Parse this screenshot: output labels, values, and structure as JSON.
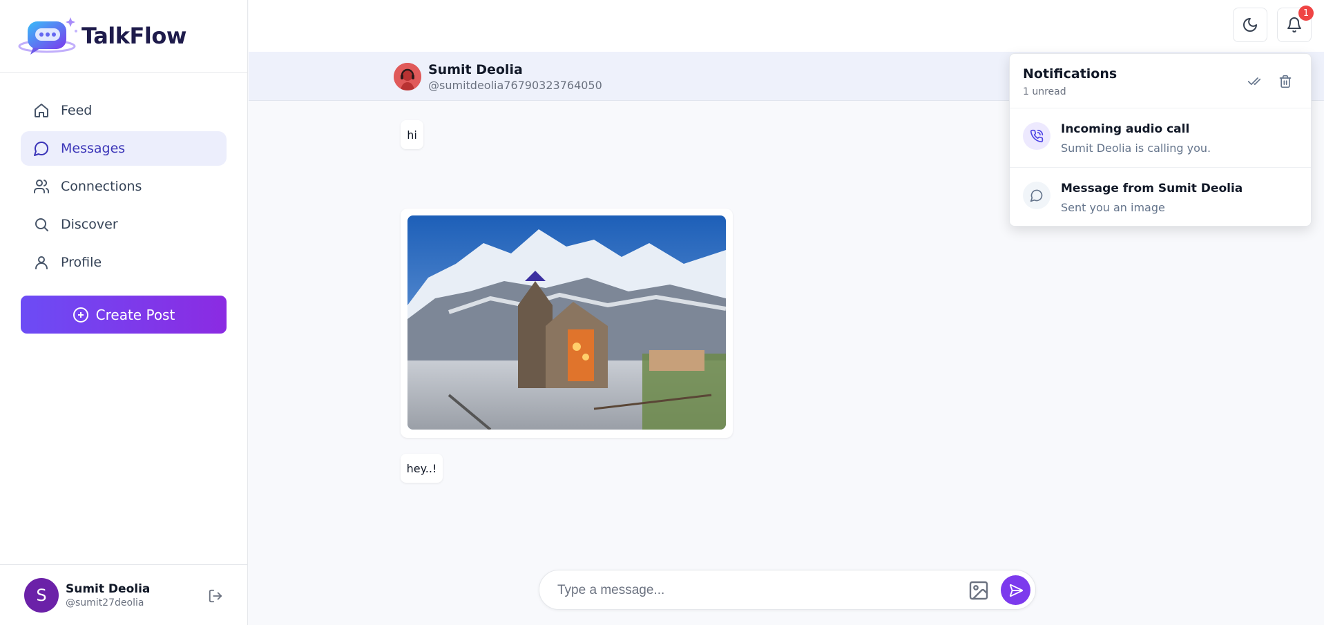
{
  "brand": {
    "name": "TalkFlow"
  },
  "nav": {
    "items": [
      {
        "label": "Feed",
        "icon": "home-icon"
      },
      {
        "label": "Messages",
        "icon": "message-icon"
      },
      {
        "label": "Connections",
        "icon": "users-icon"
      },
      {
        "label": "Discover",
        "icon": "search-icon"
      },
      {
        "label": "Profile",
        "icon": "user-icon"
      }
    ],
    "active": "Messages"
  },
  "create_post": {
    "label": "Create Post"
  },
  "current_user": {
    "initial": "S",
    "name": "Sumit Deolia",
    "handle": "@sumit27deolia"
  },
  "topbar": {
    "notification_count": "1"
  },
  "chat": {
    "contact_name": "Sumit Deolia",
    "contact_handle": "@sumitdeolia76790323764050",
    "messages": [
      {
        "type": "text",
        "text": "hi"
      },
      {
        "type": "image",
        "alt": "Snowy mountain temple photo"
      },
      {
        "type": "text",
        "text": "hey..!"
      }
    ]
  },
  "composer": {
    "placeholder": "Type a message..."
  },
  "notifications": {
    "title": "Notifications",
    "subtitle": "1 unread",
    "items": [
      {
        "title": "Incoming audio call",
        "body": "Sumit Deolia is calling you.",
        "icon": "phone-call-icon"
      },
      {
        "title": "Message from Sumit Deolia",
        "body": "Sent you an image",
        "icon": "message-icon"
      }
    ]
  },
  "colors": {
    "accent": "#3b35b8",
    "gradient_start": "#6c4cf5",
    "gradient_end": "#8b2be2",
    "send": "#7c3aed",
    "badge": "#ef4444"
  }
}
